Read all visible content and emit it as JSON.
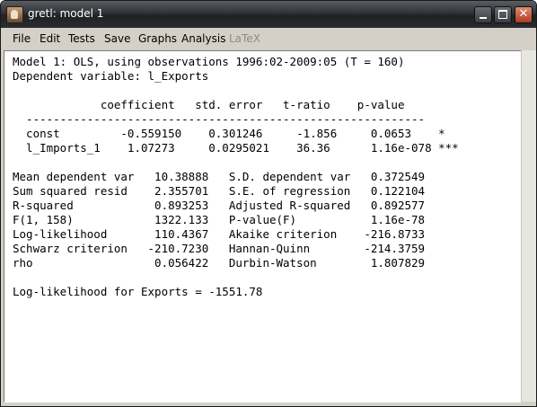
{
  "window": {
    "title": "gretl: model 1"
  },
  "menu": {
    "items": [
      {
        "label": "File",
        "enabled": true
      },
      {
        "label": "Edit",
        "enabled": true
      },
      {
        "label": "Tests",
        "enabled": true
      },
      {
        "label": "Save",
        "enabled": true
      },
      {
        "label": "Graphs",
        "enabled": true
      },
      {
        "label": "Analysis",
        "enabled": true
      },
      {
        "label": "LaTeX",
        "enabled": false
      }
    ]
  },
  "output": {
    "line_model": "Model 1: OLS, using observations 1996:02-2009:05 (T = 160)",
    "line_depvar": "Dependent variable: l_Exports",
    "table_header": "             coefficient   std. error   t-ratio    p-value",
    "rule": "  -----------------------------------------------------------",
    "row_const": "  const         -0.559150    0.301246     -1.856     0.0653    *",
    "row_imports": "  l_Imports_1    1.07273     0.0295021    36.36      1.16e-078 ***",
    "stats": [
      "Mean dependent var   10.38888   S.D. dependent var   0.372549",
      "Sum squared resid    2.355701   S.E. of regression   0.122104",
      "R-squared            0.893253   Adjusted R-squared   0.892577",
      "F(1, 158)            1322.133   P-value(F)           1.16e-78",
      "Log-likelihood       110.4367   Akaike criterion    -216.8733",
      "Schwarz criterion   -210.7230   Hannan-Quinn        -214.3759",
      "rho                  0.056422   Durbin-Watson        1.807829"
    ],
    "loglik_note": "Log-likelihood for Exports = -1551.78"
  }
}
